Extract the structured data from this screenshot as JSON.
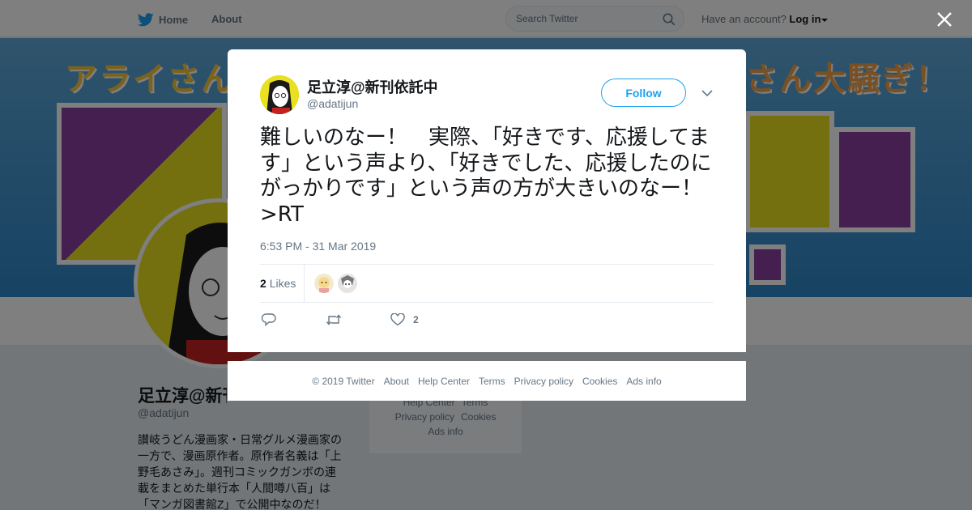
{
  "nav": {
    "home_label": "Home",
    "about_label": "About",
    "search_placeholder": "Search Twitter",
    "account_prompt": "Have an account?",
    "login_label": "Log in"
  },
  "profile": {
    "banner_left": "アライさん",
    "banner_right": "さん大騒ぎ！",
    "name": "足立淳@新刊依託中",
    "handle": "@adatijun",
    "bio": "讃岐うどん漫画家・日常グルメ漫画家の一方で、漫画原作者。原作者名義は「上野毛あさみ」。週刊コミックガンボの連載をまとめた単行本「人間噂八百」は「マンガ図書館Z」で公開中なのだ！"
  },
  "side_footer": {
    "items_row1": [
      "Help Center",
      "Terms"
    ],
    "items_row2": [
      "Privacy policy",
      "Cookies"
    ],
    "items_row3": [
      "Ads info"
    ]
  },
  "tweet": {
    "name": "足立淳@新刊依託中",
    "handle": "@adatijun",
    "follow_label": "Follow",
    "text": "難しいのなー！　実際、「好きです、応援してます」という声より、「好きでした、応援したのにがっかりです」という声の方が大きいのなー！>RT",
    "timestamp": "6:53 PM - 31 Mar 2019",
    "likes_count": "2",
    "likes_label": "Likes",
    "like_action_count": "2"
  },
  "modal_footer": {
    "items": [
      "© 2019 Twitter",
      "About",
      "Help Center",
      "Terms",
      "Privacy policy",
      "Cookies",
      "Ads info"
    ]
  },
  "colors": {
    "accent": "#1da1f2",
    "muted": "#657786",
    "text": "#14171a"
  },
  "icons": [
    "twitter-bird-icon",
    "search-icon",
    "caret-down-icon",
    "close-icon",
    "reply-icon",
    "retweet-icon",
    "heart-icon",
    "chevron-down-icon"
  ]
}
